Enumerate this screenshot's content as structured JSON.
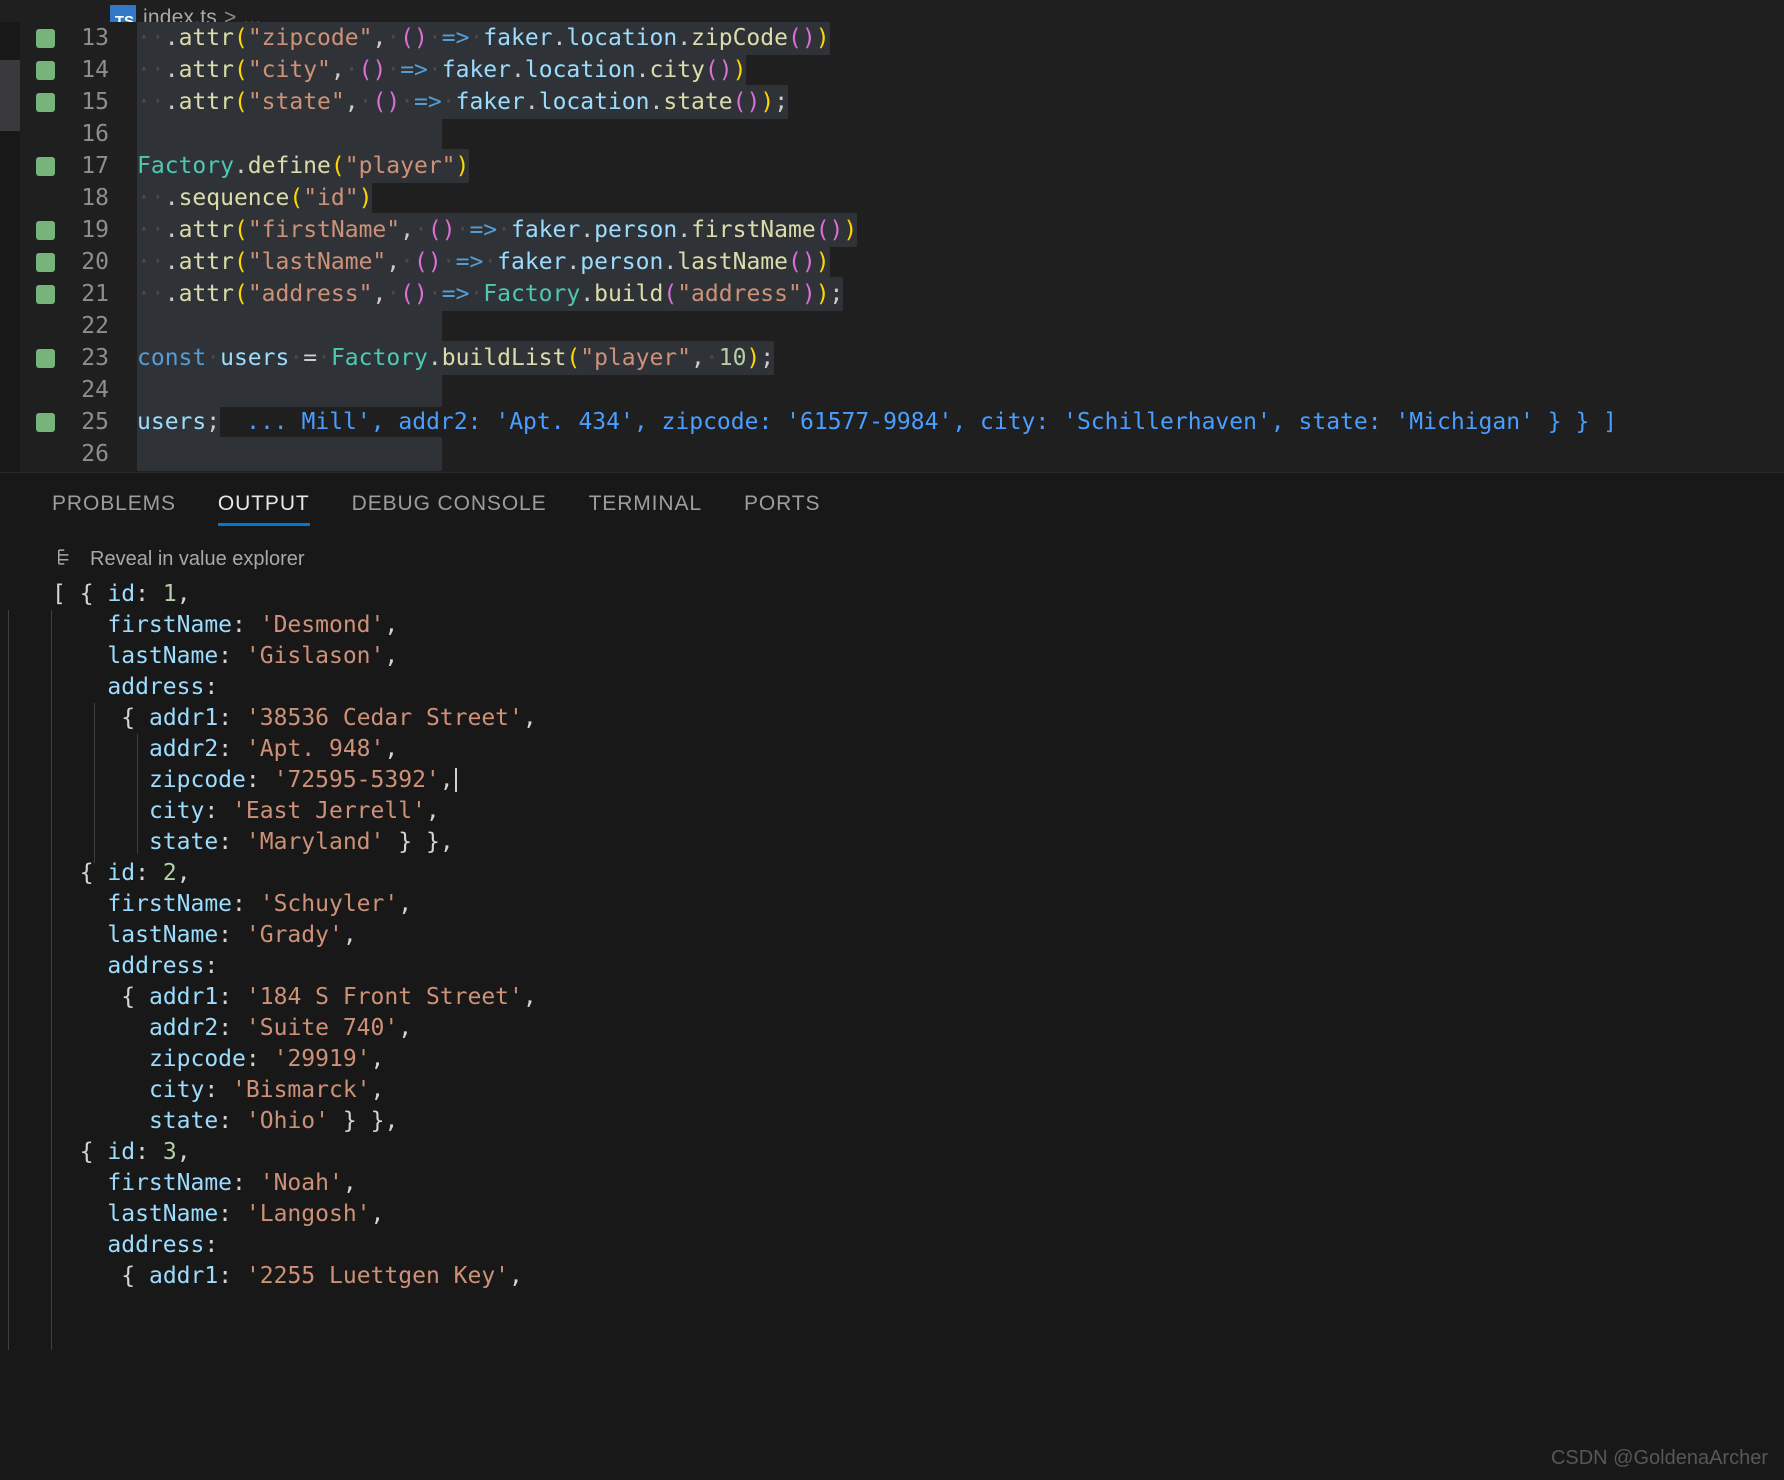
{
  "breadcrumb": {
    "file_icon": "typescript-file-icon",
    "file_icon_label": "TS",
    "file": "index.ts",
    "separator": ">",
    "ellipsis": "..."
  },
  "editor": {
    "lines": [
      {
        "num": "13",
        "covered": true,
        "text": "  .attr(\"zipcode\", () => faker.location.zipCode())"
      },
      {
        "num": "14",
        "covered": true,
        "text": "  .attr(\"city\", () => faker.location.city())"
      },
      {
        "num": "15",
        "covered": true,
        "text": "  .attr(\"state\", () => faker.location.state());"
      },
      {
        "num": "16",
        "covered": false,
        "text": ""
      },
      {
        "num": "17",
        "covered": true,
        "text": "Factory.define(\"player\")"
      },
      {
        "num": "18",
        "covered": false,
        "text": "  .sequence(\"id\")"
      },
      {
        "num": "19",
        "covered": true,
        "text": "  .attr(\"firstName\", () => faker.person.firstName())"
      },
      {
        "num": "20",
        "covered": true,
        "text": "  .attr(\"lastName\", () => faker.person.lastName())"
      },
      {
        "num": "21",
        "covered": true,
        "text": "  .attr(\"address\", () => Factory.build(\"address\"));"
      },
      {
        "num": "22",
        "covered": false,
        "text": ""
      },
      {
        "num": "23",
        "covered": true,
        "text": "const users = Factory.buildList(\"player\", 10);"
      },
      {
        "num": "24",
        "covered": false,
        "text": ""
      },
      {
        "num": "25",
        "covered": true,
        "text": "users;"
      },
      {
        "num": "26",
        "covered": false,
        "text": ""
      }
    ],
    "inline_debug_value": "... Mill', addr2: 'Apt. 434', zipcode: '61577-9984', city: 'Schillerhaven', state: 'Michigan' } } ]"
  },
  "panel": {
    "tabs": [
      {
        "label": "PROBLEMS",
        "active": false
      },
      {
        "label": "OUTPUT",
        "active": true
      },
      {
        "label": "DEBUG CONSOLE",
        "active": false
      },
      {
        "label": "TERMINAL",
        "active": false
      },
      {
        "label": "PORTS",
        "active": false
      }
    ],
    "reveal": {
      "icon": "list-tree-icon",
      "label": "Reveal in value explorer"
    },
    "output_lines": [
      "[ { id: 1,",
      "    firstName: 'Desmond',",
      "    lastName: 'Gislason',",
      "    address:",
      "     { addr1: '38536 Cedar Street',",
      "       addr2: 'Apt. 948',",
      "       zipcode: '72595-5392',",
      "       city: 'East Jerrell',",
      "       state: 'Maryland' } },",
      "  { id: 2,",
      "    firstName: 'Schuyler',",
      "    lastName: 'Grady',",
      "    address:",
      "     { addr1: '184 S Front Street',",
      "       addr2: 'Suite 740',",
      "       zipcode: '29919',",
      "       city: 'Bismarck',",
      "       state: 'Ohio' } },",
      "  { id: 3,",
      "    firstName: 'Noah',",
      "    lastName: 'Langosh',",
      "    address:",
      "     { addr1: '2255 Luettgen Key',"
    ],
    "caret_on_line_index": 6
  },
  "watermark": "CSDN @GoldenaArcher",
  "colors": {
    "editor_bg": "#1f1f1f",
    "panel_bg": "#181818",
    "coverage_green": "#76b47a",
    "active_tab_underline": "#0078d4",
    "inline_debug": "#4a9eff",
    "string": "#ce9178",
    "key": "#9cdcfe",
    "number": "#b5cea8"
  }
}
